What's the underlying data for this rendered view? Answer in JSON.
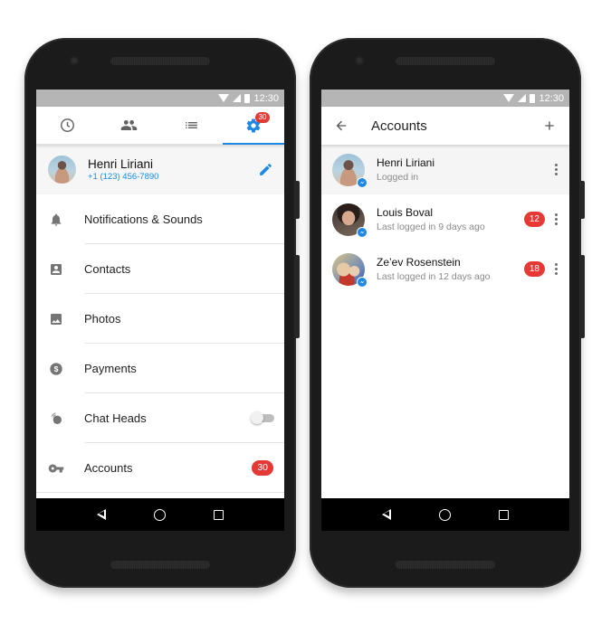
{
  "status_bar": {
    "time": "12:30"
  },
  "settings_screen": {
    "tabs": [
      {
        "name": "recent",
        "icon": "clock-icon"
      },
      {
        "name": "people",
        "icon": "people-icon"
      },
      {
        "name": "groups",
        "icon": "list-icon"
      },
      {
        "name": "settings",
        "icon": "gear-icon",
        "badge": "30",
        "active": true
      }
    ],
    "profile": {
      "name": "Henri Liriani",
      "phone": "+1 (123) 456-7890"
    },
    "menu": [
      {
        "label": "Notifications & Sounds",
        "icon": "bell-icon"
      },
      {
        "label": "Contacts",
        "icon": "contact-card-icon"
      },
      {
        "label": "Photos",
        "icon": "photo-icon"
      },
      {
        "label": "Payments",
        "icon": "dollar-icon"
      },
      {
        "label": "Chat Heads",
        "icon": "chat-heads-icon",
        "toggle": false
      },
      {
        "label": "Accounts",
        "icon": "key-icon",
        "badge": "30"
      }
    ]
  },
  "accounts_screen": {
    "title": "Accounts",
    "accounts": [
      {
        "name": "Henri Liriani",
        "status": "Logged in"
      },
      {
        "name": "Louis Boval",
        "status": "Last logged in 9 days ago",
        "badge": "12"
      },
      {
        "name": "Ze’ev Rosenstein",
        "status": "Last logged in 12 days ago",
        "badge": "18"
      }
    ]
  },
  "colors": {
    "accent": "#1e88e5",
    "badge": "#e53935",
    "status_bar": "#b5b5b5"
  }
}
